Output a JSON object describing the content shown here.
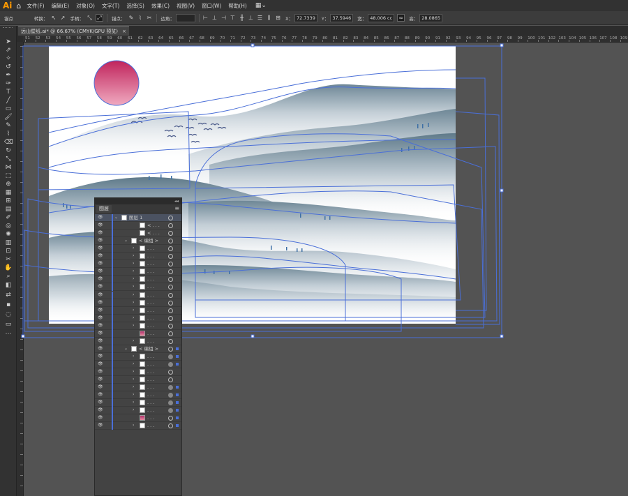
{
  "app": {
    "logo": "Ai",
    "home_icon": "home-icon"
  },
  "menu": [
    "文件(F)",
    "编辑(E)",
    "对象(O)",
    "文字(T)",
    "选择(S)",
    "效果(C)",
    "视图(V)",
    "窗口(W)",
    "帮助(H)"
  ],
  "control_bar": {
    "anchor_label": "锚点",
    "convert_label": "转换：",
    "handle_label": "手柄：",
    "anchor_label2": "锚点：",
    "corner_label": "边角：",
    "x_label": "X：",
    "x_value": "72.7339",
    "y_label": "Y：",
    "y_value": "37.5946",
    "w_label": "宽：",
    "w_value": "48.006 cc",
    "h_label": "高：",
    "h_value": "28.0865"
  },
  "document_tab": {
    "title": "远山壁纸.ai* @ 66.67% (CMYK/GPU 预览)",
    "close": "×"
  },
  "ruler": {
    "h_numbers": [
      "51",
      "52",
      "53",
      "54",
      "55",
      "56",
      "57",
      "58",
      "59",
      "60",
      "61",
      "62",
      "63",
      "64",
      "65",
      "66",
      "67",
      "68",
      "69",
      "70",
      "71",
      "72",
      "73",
      "74",
      "75",
      "76",
      "77",
      "78",
      "79",
      "80",
      "81",
      "82",
      "83",
      "84",
      "85",
      "86",
      "87",
      "88",
      "89",
      "90",
      "91",
      "92",
      "93",
      "94",
      "95",
      "96",
      "97",
      "98",
      "99",
      "100",
      "101",
      "102",
      "103",
      "104",
      "105",
      "106",
      "107",
      "108",
      "109"
    ]
  },
  "layers_panel": {
    "collapse": "◂◂",
    "tab_label": "图层",
    "menu_icon": "≡",
    "rows": [
      {
        "name": "图层 1",
        "indent": 0,
        "arrow": "⌄",
        "thumb": "plain",
        "selected": true,
        "target": "o"
      },
      {
        "name": "< . . .",
        "indent": 2,
        "arrow": "",
        "thumb": "plain",
        "target": "o"
      },
      {
        "name": "< . . .",
        "indent": 2,
        "arrow": "",
        "thumb": "plain",
        "target": "o"
      },
      {
        "name": "< 编组 >",
        "indent": 1,
        "arrow": "⌄",
        "thumb": "plain",
        "target": "o"
      },
      {
        "name": ". . .",
        "indent": 2,
        "arrow": "›",
        "thumb": "plain",
        "target": "o"
      },
      {
        "name": ". . .",
        "indent": 2,
        "arrow": "›",
        "thumb": "plain",
        "target": "o"
      },
      {
        "name": ". . .",
        "indent": 2,
        "arrow": "›",
        "thumb": "plain",
        "target": "o"
      },
      {
        "name": ". . .",
        "indent": 2,
        "arrow": "›",
        "thumb": "plain",
        "target": "o"
      },
      {
        "name": ". . .",
        "indent": 2,
        "arrow": "›",
        "thumb": "plain",
        "target": "o"
      },
      {
        "name": ". . .",
        "indent": 2,
        "arrow": "›",
        "thumb": "plain",
        "target": "o"
      },
      {
        "name": ". . .",
        "indent": 2,
        "arrow": "›",
        "thumb": "plain",
        "target": "o"
      },
      {
        "name": ". . .",
        "indent": 2,
        "arrow": "›",
        "thumb": "plain",
        "target": "o"
      },
      {
        "name": ". . .",
        "indent": 2,
        "arrow": "›",
        "thumb": "plain",
        "target": "o"
      },
      {
        "name": ". . .",
        "indent": 2,
        "arrow": "›",
        "thumb": "plain",
        "target": "o"
      },
      {
        "name": ". . .",
        "indent": 2,
        "arrow": "›",
        "thumb": "plain",
        "target": "o"
      },
      {
        "name": ". . .",
        "indent": 2,
        "arrow": "",
        "thumb": "sun",
        "target": "o"
      },
      {
        "name": ". . .",
        "indent": 2,
        "arrow": "›",
        "thumb": "plain",
        "target": "o"
      },
      {
        "name": "< 编组 >",
        "indent": 1,
        "arrow": "⌄",
        "thumb": "plain",
        "target": "o",
        "sq": true
      },
      {
        "name": ". . .",
        "indent": 2,
        "arrow": "›",
        "thumb": "plain",
        "target": "f",
        "sq": true
      },
      {
        "name": ". . .",
        "indent": 2,
        "arrow": "›",
        "thumb": "plain",
        "target": "f",
        "sq": true
      },
      {
        "name": ". . .",
        "indent": 2,
        "arrow": "›",
        "thumb": "plain",
        "target": "o"
      },
      {
        "name": ". . .",
        "indent": 2,
        "arrow": "›",
        "thumb": "plain",
        "target": "o"
      },
      {
        "name": ". . .",
        "indent": 2,
        "arrow": "›",
        "thumb": "plain",
        "target": "f",
        "sq": true
      },
      {
        "name": ". . .",
        "indent": 2,
        "arrow": "›",
        "thumb": "plain",
        "target": "f",
        "sq": true
      },
      {
        "name": ". . .",
        "indent": 2,
        "arrow": "›",
        "thumb": "plain",
        "target": "f",
        "sq": true
      },
      {
        "name": ". . .",
        "indent": 2,
        "arrow": "›",
        "thumb": "plain",
        "target": "f",
        "sq": true
      },
      {
        "name": ". . .",
        "indent": 2,
        "arrow": "",
        "thumb": "sun",
        "target": "o",
        "sq": true
      },
      {
        "name": ". . .",
        "indent": 2,
        "arrow": "›",
        "thumb": "plain",
        "target": "o",
        "sq": true
      }
    ]
  },
  "colors": {
    "selection": "#4a6fd8",
    "sun_top": "#c0245c",
    "sun_bottom": "#eea3b8",
    "mountain": "#6e8796"
  }
}
